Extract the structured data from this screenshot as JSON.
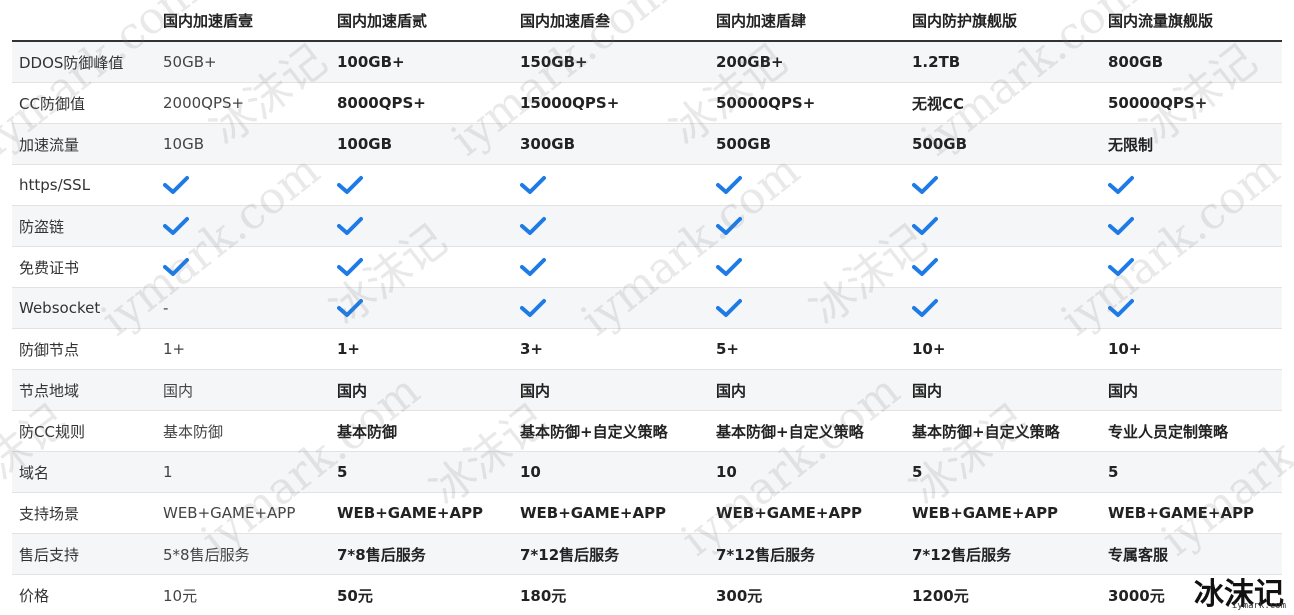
{
  "columns": [
    "国内加速盾壹",
    "国内加速盾贰",
    "国内加速盾叁",
    "国内加速盾肆",
    "国内防护旗舰版",
    "国内流量旗舰版"
  ],
  "rows": [
    {
      "label": "DDOS防御峰值",
      "values": [
        "50GB+",
        "100GB+",
        "150GB+",
        "200GB+",
        "1.2TB",
        "800GB"
      ]
    },
    {
      "label": "CC防御值",
      "values": [
        "2000QPS+",
        "8000QPS+",
        "15000QPS+",
        "50000QPS+",
        "无视CC",
        "50000QPS+"
      ]
    },
    {
      "label": "加速流量",
      "values": [
        "10GB",
        "100GB",
        "300GB",
        "500GB",
        "500GB",
        "无限制"
      ]
    },
    {
      "label": "https/SSL",
      "values": [
        "check",
        "check",
        "check",
        "check",
        "check",
        "check"
      ]
    },
    {
      "label": "防盗链",
      "values": [
        "check",
        "check",
        "check",
        "check",
        "check",
        "check"
      ]
    },
    {
      "label": "免费证书",
      "values": [
        "check",
        "check",
        "check",
        "check",
        "check",
        "check"
      ]
    },
    {
      "label": "Websocket",
      "values": [
        "-",
        "check",
        "check",
        "check",
        "check",
        "check"
      ]
    },
    {
      "label": "防御节点",
      "values": [
        "1+",
        "1+",
        "3+",
        "5+",
        "10+",
        "10+"
      ]
    },
    {
      "label": "节点地域",
      "values": [
        "国内",
        "国内",
        "国内",
        "国内",
        "国内",
        "国内"
      ]
    },
    {
      "label": "防CC规则",
      "values": [
        "基本防御",
        "基本防御",
        "基本防御+自定义策略",
        "基本防御+自定义策略",
        "基本防御+自定义策略",
        "专业人员定制策略"
      ]
    },
    {
      "label": "域名",
      "values": [
        "1",
        "5",
        "10",
        "10",
        "5",
        "5"
      ]
    },
    {
      "label": "支持场景",
      "values": [
        "WEB+GAME+APP",
        "WEB+GAME+APP",
        "WEB+GAME+APP",
        "WEB+GAME+APP",
        "WEB+GAME+APP",
        "WEB+GAME+APP"
      ]
    },
    {
      "label": "售后支持",
      "values": [
        "5*8售后服务",
        "7*8售后服务",
        "7*12售后服务",
        "7*12售后服务",
        "7*12售后服务",
        "专属客服"
      ]
    },
    {
      "label": "价格",
      "values": [
        "10元",
        "50元",
        "180元",
        "300元",
        "1200元",
        "3000元"
      ]
    }
  ],
  "watermark": {
    "text_cn": "冰沫记",
    "text_en": "iymark.com"
  },
  "logo": {
    "mark": "冰沫记",
    "sub": "iymark.com"
  },
  "colors": {
    "check": "#1e7be6",
    "header_rule": "#333333"
  },
  "icons": {
    "check": "check-icon"
  }
}
